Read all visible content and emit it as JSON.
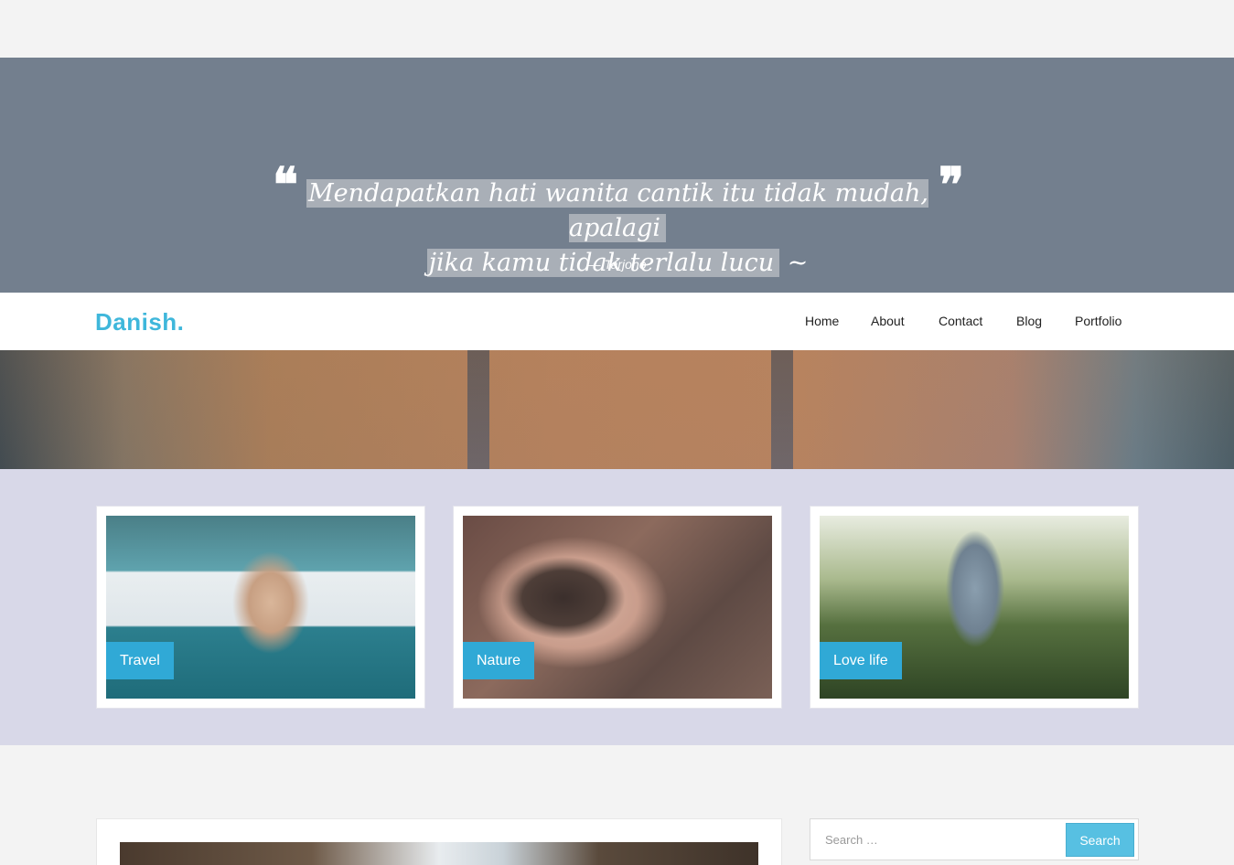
{
  "quote": {
    "line1": "Mendapatkan hati wanita cantik itu tidak mudah, apalagi",
    "line2": "jika kamu tidak terlalu lucu",
    "tail": " ~",
    "author": "— Tarjono",
    "open_mark": "❝",
    "close_mark": "❞"
  },
  "nav": {
    "logo": "Danish.",
    "items": [
      "Home",
      "About",
      "Contact",
      "Blog",
      "Portfolio"
    ]
  },
  "categories": [
    {
      "label": "Travel"
    },
    {
      "label": "Nature"
    },
    {
      "label": "Love life"
    }
  ],
  "search": {
    "placeholder": "Search …",
    "button": "Search"
  },
  "colors": {
    "accent": "#3fb7db",
    "quote_bg": "#737f8e",
    "category_bg": "#d8d8e8",
    "label_bg": "#30a9d6"
  }
}
